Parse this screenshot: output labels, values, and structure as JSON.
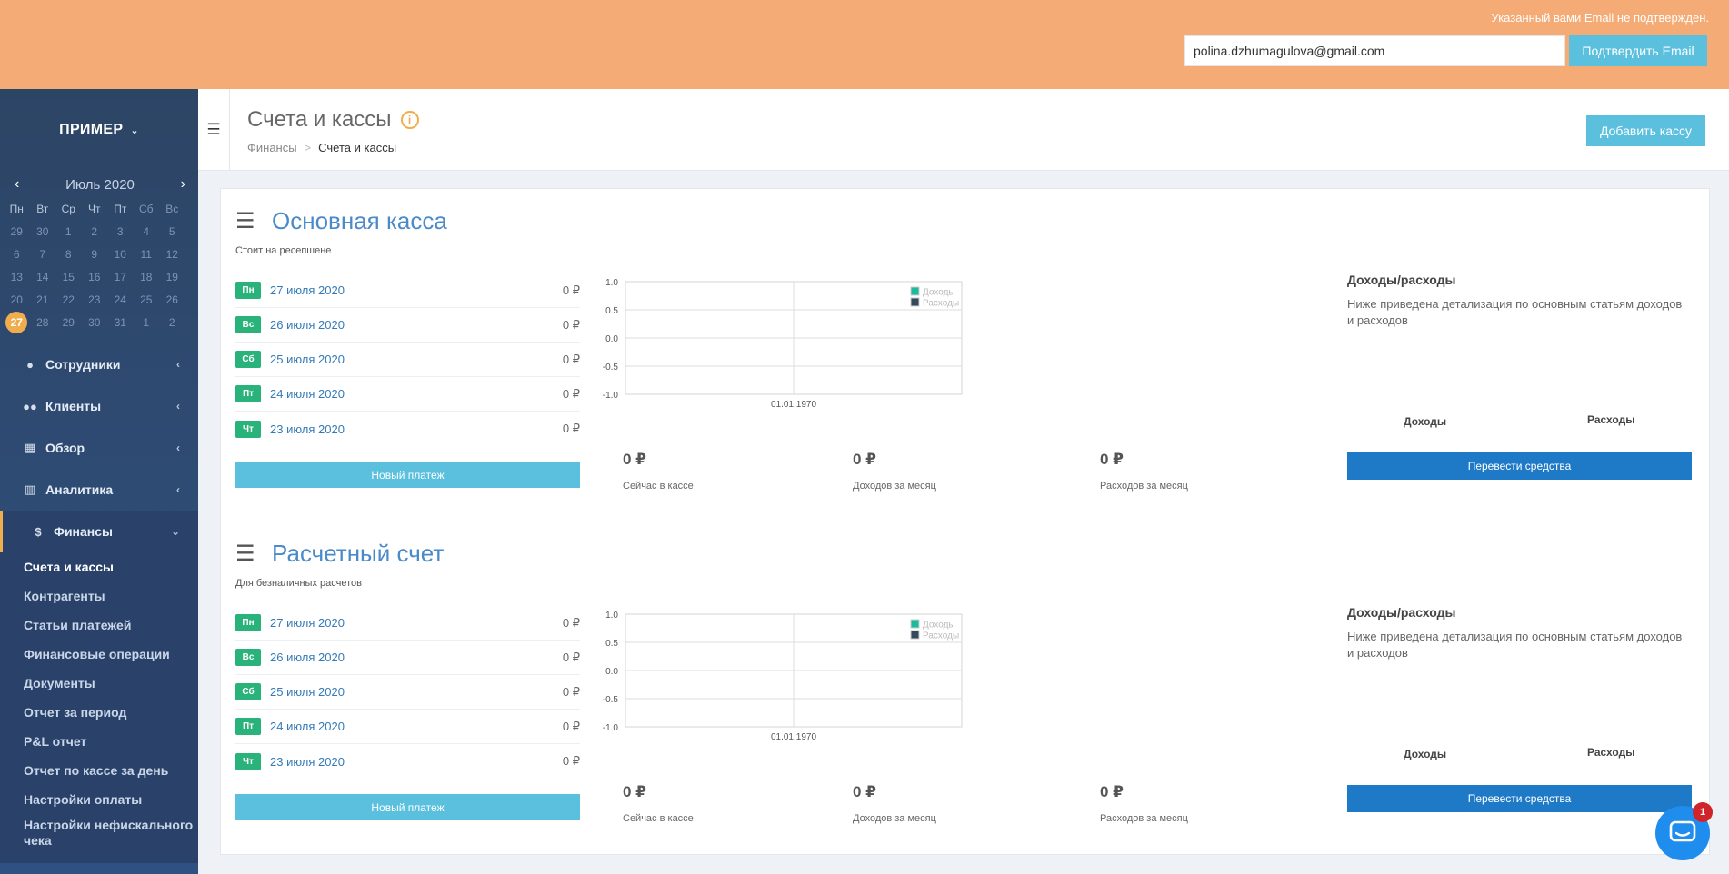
{
  "banner": {
    "message": "Указанный вами Email не подтвержден.",
    "email_value": "polina.dzhumagulova@gmail.com",
    "confirm_label": "Подтвердить Email"
  },
  "sidebar": {
    "org_name": "ПРИМЕР",
    "calendar": {
      "month_label": "Июль 2020",
      "weekdays": [
        "Пн",
        "Вт",
        "Ср",
        "Чт",
        "Пт",
        "Сб",
        "Вс"
      ],
      "weeks": [
        [
          "29",
          "30",
          "1",
          "2",
          "3",
          "4",
          "5"
        ],
        [
          "6",
          "7",
          "8",
          "9",
          "10",
          "11",
          "12"
        ],
        [
          "13",
          "14",
          "15",
          "16",
          "17",
          "18",
          "19"
        ],
        [
          "20",
          "21",
          "22",
          "23",
          "24",
          "25",
          "26"
        ],
        [
          "27",
          "28",
          "29",
          "30",
          "31",
          "1",
          "2"
        ]
      ],
      "today": "27"
    },
    "nav": [
      {
        "label": "Сотрудники",
        "icon": "user-icon"
      },
      {
        "label": "Клиенты",
        "icon": "users-icon"
      },
      {
        "label": "Обзор",
        "icon": "grid-icon"
      },
      {
        "label": "Аналитика",
        "icon": "bar-chart-icon"
      },
      {
        "label": "Финансы",
        "icon": "dollar-icon"
      }
    ],
    "finance_sub": [
      "Счета и кассы",
      "Контрагенты",
      "Статьи платежей",
      "Финансовые операции",
      "Документы",
      "Отчет за период",
      "P&L отчет",
      "Отчет по кассе за день",
      "Настройки оплаты",
      "Настройки нефискального чека"
    ]
  },
  "header": {
    "title": "Счета и кассы",
    "breadcrumb": [
      "Финансы",
      "Счета и кассы"
    ],
    "add_button": "Добавить кассу"
  },
  "accounts": [
    {
      "title": "Основная касса",
      "description": "Стоит на ресепшене",
      "days": [
        {
          "dow": "Пн",
          "date": "27 июля 2020",
          "amount": "0 ₽"
        },
        {
          "dow": "Вс",
          "date": "26 июля 2020",
          "amount": "0 ₽"
        },
        {
          "dow": "Сб",
          "date": "25 июля 2020",
          "amount": "0 ₽"
        },
        {
          "dow": "Пт",
          "date": "24 июля 2020",
          "amount": "0 ₽"
        },
        {
          "dow": "Чт",
          "date": "23 июля 2020",
          "amount": "0 ₽"
        }
      ],
      "new_payment": "Новый платеж",
      "stats": [
        {
          "value": "0 ₽",
          "label": "Сейчас в кассе"
        },
        {
          "value": "0 ₽",
          "label": "Доходов за месяц"
        },
        {
          "value": "0 ₽",
          "label": "Расходов за месяц"
        }
      ],
      "ie_title": "Доходы/расходы",
      "ie_text": "Ниже приведена детализация по основным статьям доходов и расходов",
      "ie_col_income": "Доходы",
      "ie_col_expense": "Расходы",
      "transfer": "Перевести средства"
    },
    {
      "title": "Расчетный счет",
      "description": "Для безналичных расчетов",
      "days": [
        {
          "dow": "Пн",
          "date": "27 июля 2020",
          "amount": "0 ₽"
        },
        {
          "dow": "Вс",
          "date": "26 июля 2020",
          "amount": "0 ₽"
        },
        {
          "dow": "Сб",
          "date": "25 июля 2020",
          "amount": "0 ₽"
        },
        {
          "dow": "Пт",
          "date": "24 июля 2020",
          "amount": "0 ₽"
        },
        {
          "dow": "Чт",
          "date": "23 июля 2020",
          "amount": "0 ₽"
        }
      ],
      "new_payment": "Новый платеж",
      "stats": [
        {
          "value": "0 ₽",
          "label": "Сейчас в кассе"
        },
        {
          "value": "0 ₽",
          "label": "Доходов за месяц"
        },
        {
          "value": "0 ₽",
          "label": "Расходов за месяц"
        }
      ],
      "ie_title": "Доходы/расходы",
      "ie_text": "Ниже приведена детализация по основным статьям доходов и расходов",
      "ie_col_income": "Доходы",
      "ie_col_expense": "Расходы",
      "transfer": "Перевести средства"
    }
  ],
  "chart_data": [
    {
      "type": "line",
      "x": [
        "01.01.1970"
      ],
      "series": [
        {
          "name": "Доходы",
          "color": "#1abc9c",
          "values": []
        },
        {
          "name": "Расходы",
          "color": "#34495e",
          "values": []
        }
      ],
      "yticks": [
        "1.0",
        "0.5",
        "0.0",
        "-0.5",
        "-1.0"
      ],
      "ylim": [
        -1,
        1
      ],
      "grid": true,
      "legend": "top-right"
    },
    {
      "type": "line",
      "x": [
        "01.01.1970"
      ],
      "series": [
        {
          "name": "Доходы",
          "color": "#1abc9c",
          "values": []
        },
        {
          "name": "Расходы",
          "color": "#34495e",
          "values": []
        }
      ],
      "yticks": [
        "1.0",
        "0.5",
        "0.0",
        "-0.5",
        "-1.0"
      ],
      "ylim": [
        -1,
        1
      ],
      "grid": true,
      "legend": "top-right"
    }
  ],
  "chat": {
    "badge_count": "1"
  }
}
